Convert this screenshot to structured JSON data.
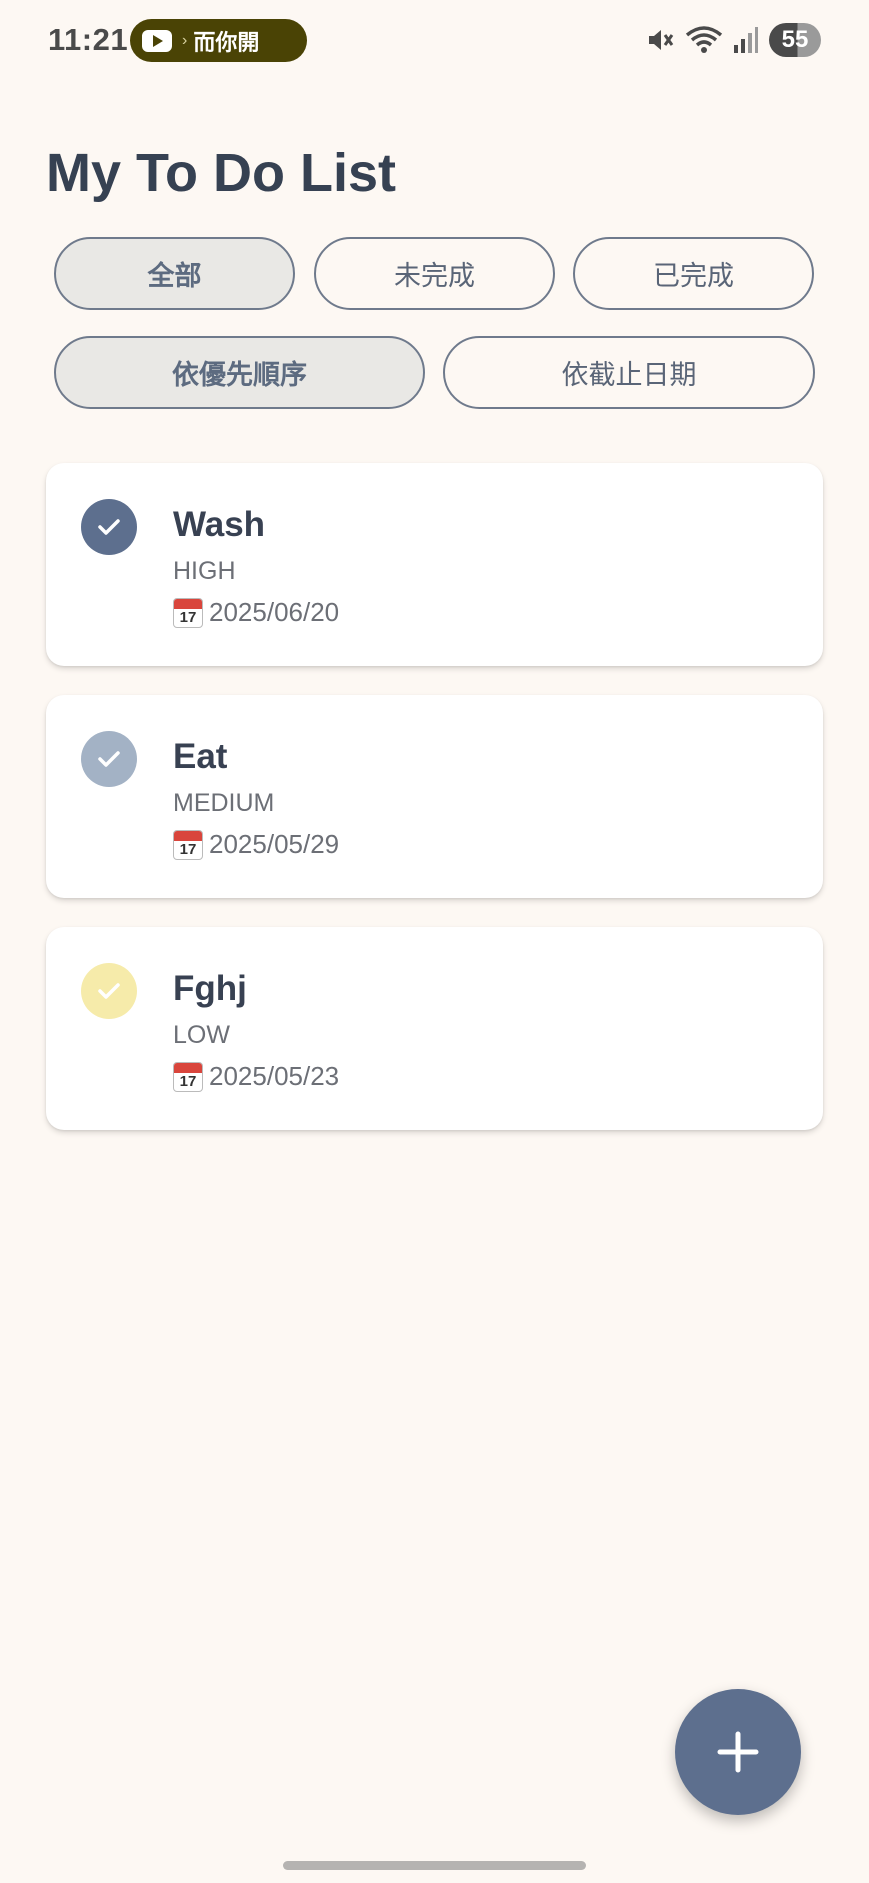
{
  "status_bar": {
    "time": "11:21",
    "media_text": "而你開",
    "battery": "55",
    "icons": [
      "youtube-icon",
      "mute-icon",
      "wifi-icon",
      "signal-icon",
      "battery-icon"
    ]
  },
  "page_title": "My To Do List",
  "filters": {
    "all": "全部",
    "incomplete": "未完成",
    "completed": "已完成",
    "selected": "all"
  },
  "sort": {
    "by_priority": "依優先順序",
    "by_due_date": "依截止日期",
    "selected": "by_priority"
  },
  "tasks": [
    {
      "title": "Wash",
      "priority": "HIGH",
      "date": "2025/06/20",
      "check_color": "#5d6f8e"
    },
    {
      "title": "Eat",
      "priority": "MEDIUM",
      "date": "2025/05/29",
      "check_color": "#a3b2c5"
    },
    {
      "title": "Fghj",
      "priority": "LOW",
      "date": "2025/05/23",
      "check_color": "#f6ebaa"
    }
  ],
  "calendar_icon_day": "17",
  "fab_icon": "plus-icon",
  "colors": {
    "background": "#fdf8f3",
    "accent": "#5d6f8e",
    "text_primary": "#384152"
  }
}
